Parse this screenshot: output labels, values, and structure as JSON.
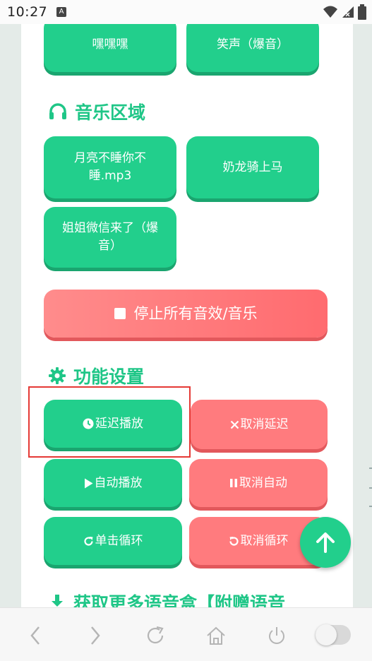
{
  "status_bar": {
    "time": "10:27",
    "notification_badge": "A",
    "icons": [
      "wifi-icon",
      "signal-icon",
      "battery-icon"
    ]
  },
  "sound_buttons": {
    "row1": [
      "嘿嘿嘿",
      "笑声（爆音）"
    ]
  },
  "music_section": {
    "title": "音乐区域",
    "icon": "headphones-icon",
    "items": [
      "月亮不睡你不睡.mp3",
      "奶龙骑上马",
      "姐姐微信来了（爆音）"
    ]
  },
  "stop_button": {
    "label": "停止所有音效/音乐",
    "icon": "stop-icon"
  },
  "settings_section": {
    "title": "功能设置",
    "icon": "gear-icon",
    "buttons": [
      {
        "label": "延迟播放",
        "icon": "clock-icon"
      },
      {
        "label": "取消延迟",
        "icon": "x-icon"
      },
      {
        "label": "自动播放",
        "icon": "play-icon"
      },
      {
        "label": "取消自动",
        "icon": "pause-icon"
      },
      {
        "label": "单击循环",
        "icon": "redo-icon"
      },
      {
        "label": "取消循环",
        "icon": "undo-icon"
      }
    ]
  },
  "download_section": {
    "title": "获取更多语音盒【附赠语音",
    "icon": "download-icon"
  },
  "fab": {
    "icon": "arrow-up-icon"
  },
  "colors": {
    "green": "#22cf8c",
    "green_dark": "#1aa56f",
    "red": "#ff7b7e",
    "title_green": "#1fc687",
    "highlight": "#e53935"
  },
  "browser_nav": {
    "items": [
      "back-icon",
      "forward-icon",
      "refresh-icon",
      "home-icon",
      "power-icon",
      "toggle-switch"
    ]
  }
}
